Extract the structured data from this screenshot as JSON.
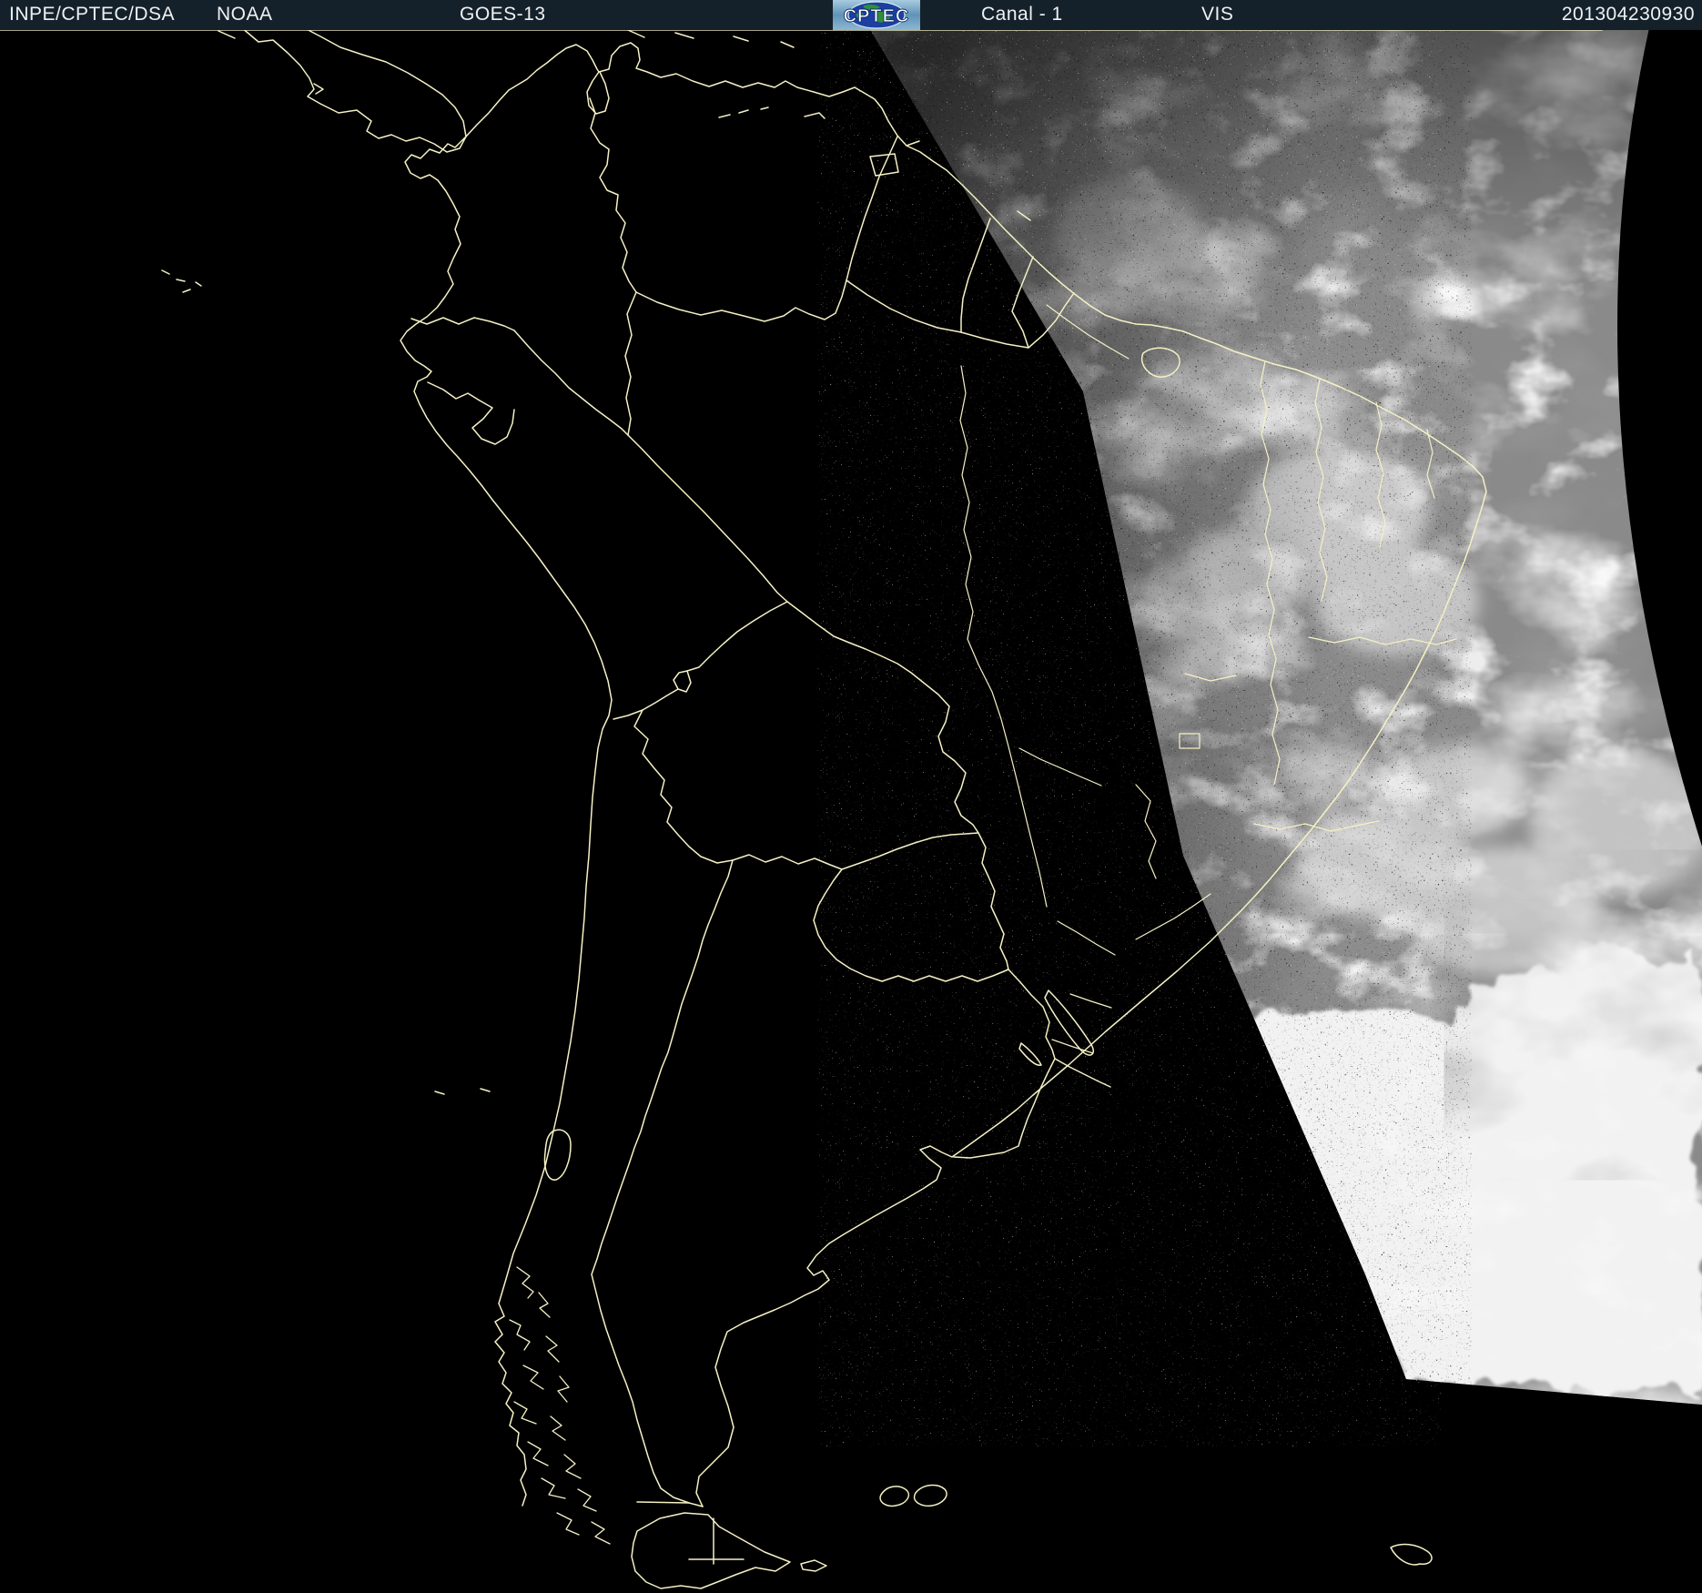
{
  "header": {
    "institution": "INPE/CPTEC/DSA",
    "agency": "NOAA",
    "satellite": "GOES-13",
    "channel": "Canal - 1",
    "band": "VIS",
    "timestamp": "201304230930",
    "logo_text": "CPTEC"
  },
  "colors": {
    "header_bg": "#15212a",
    "header_text": "#edf1f3",
    "map_outline": "#f5f1c4",
    "night": "#000000",
    "cloud_base": "#8a8a8a",
    "cloud_bright": "#f3f3f3",
    "logo_globe": "#1c3fa0",
    "logo_land": "#2f8f3a"
  }
}
